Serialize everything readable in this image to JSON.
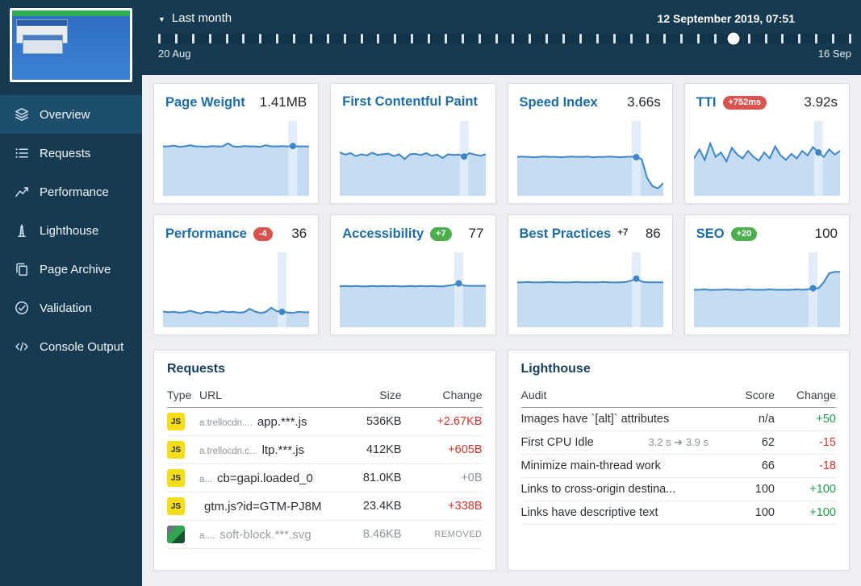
{
  "colors": {
    "sidebar_bg": "#153a52",
    "active_item_bg": "#1d4e6e",
    "accent_blue": "#1b6ca8",
    "chart_line": "#3e86c7",
    "chart_fill": "#c5dcf2",
    "badge_red": "#d9534f",
    "badge_green": "#4cae4c",
    "text_red": "#d9342b",
    "text_green": "#1f9d49"
  },
  "sidebar": {
    "items": [
      {
        "label": "Overview",
        "icon": "layers-icon",
        "active": true
      },
      {
        "label": "Requests",
        "icon": "list-icon",
        "active": false
      },
      {
        "label": "Performance",
        "icon": "performance-chart-icon",
        "active": false
      },
      {
        "label": "Lighthouse",
        "icon": "lighthouse-icon",
        "active": false
      },
      {
        "label": "Page Archive",
        "icon": "pages-icon",
        "active": false
      },
      {
        "label": "Validation",
        "icon": "check-circle-icon",
        "active": false
      },
      {
        "label": "Console Output",
        "icon": "code-icon",
        "active": false
      }
    ]
  },
  "timebar": {
    "range_label": "Last month",
    "current_datetime": "12 September 2019, 07:51",
    "start_label": "20 Aug",
    "end_label": "16 Sep",
    "tick_count": 42,
    "handle_position": 0.83
  },
  "cards": [
    {
      "title": "Page Weight",
      "value": "1.41MB",
      "badge": null,
      "cursor": 24,
      "spark": [
        0.66,
        0.66,
        0.67,
        0.655,
        0.66,
        0.675,
        0.66,
        0.66,
        0.655,
        0.665,
        0.66,
        0.66,
        0.7,
        0.66,
        0.655,
        0.665,
        0.66,
        0.66,
        0.655,
        0.675,
        0.66,
        0.66,
        0.665,
        0.66,
        0.665,
        0.66,
        0.66,
        0.66
      ]
    },
    {
      "title": "First Contentful Paint",
      "value": "",
      "badge": null,
      "cursor": 23,
      "spark": [
        0.58,
        0.55,
        0.57,
        0.53,
        0.555,
        0.54,
        0.575,
        0.545,
        0.555,
        0.565,
        0.53,
        0.555,
        0.49,
        0.555,
        0.56,
        0.545,
        0.57,
        0.535,
        0.55,
        0.505,
        0.555,
        0.545,
        0.55,
        0.525,
        0.57,
        0.55,
        0.535,
        0.555
      ]
    },
    {
      "title": "Speed Index",
      "value": "3.66s",
      "badge": null,
      "cursor": 22,
      "spark": [
        0.52,
        0.525,
        0.52,
        0.515,
        0.52,
        0.525,
        0.52,
        0.52,
        0.515,
        0.52,
        0.525,
        0.52,
        0.52,
        0.525,
        0.515,
        0.52,
        0.52,
        0.525,
        0.52,
        0.515,
        0.52,
        0.525,
        0.515,
        0.49,
        0.24,
        0.13,
        0.1,
        0.17
      ]
    },
    {
      "title": "TTI",
      "value": "3.92s",
      "badge": {
        "text": "+752ms",
        "style": "red"
      },
      "cursor": 23,
      "spark": [
        0.5,
        0.62,
        0.48,
        0.7,
        0.52,
        0.58,
        0.46,
        0.64,
        0.55,
        0.5,
        0.6,
        0.52,
        0.47,
        0.58,
        0.5,
        0.66,
        0.54,
        0.48,
        0.56,
        0.5,
        0.6,
        0.54,
        0.65,
        0.58,
        0.52,
        0.62,
        0.55,
        0.6
      ]
    },
    {
      "title": "Performance",
      "value": "36",
      "badge": {
        "text": "-4",
        "style": "red"
      },
      "cursor": 22,
      "spark": [
        0.21,
        0.2,
        0.205,
        0.195,
        0.2,
        0.22,
        0.2,
        0.185,
        0.205,
        0.2,
        0.195,
        0.215,
        0.2,
        0.205,
        0.195,
        0.2,
        0.245,
        0.21,
        0.19,
        0.205,
        0.26,
        0.215,
        0.205,
        0.198,
        0.19,
        0.205,
        0.2,
        0.2
      ]
    },
    {
      "title": "Accessibility",
      "value": "77",
      "badge": {
        "text": "+7",
        "style": "green"
      },
      "cursor": 22,
      "spark": [
        0.545,
        0.55,
        0.545,
        0.55,
        0.545,
        0.545,
        0.55,
        0.545,
        0.55,
        0.545,
        0.55,
        0.545,
        0.545,
        0.55,
        0.545,
        0.55,
        0.545,
        0.55,
        0.545,
        0.545,
        0.555,
        0.565,
        0.585,
        0.555,
        0.553,
        0.553,
        0.553,
        0.553
      ]
    },
    {
      "title": "Best Practices",
      "value": "86",
      "badge": {
        "text": "+7",
        "style": "plain"
      },
      "cursor": 22,
      "spark": [
        0.6,
        0.6,
        0.605,
        0.598,
        0.6,
        0.6,
        0.605,
        0.6,
        0.6,
        0.598,
        0.6,
        0.605,
        0.6,
        0.6,
        0.6,
        0.6,
        0.605,
        0.6,
        0.598,
        0.6,
        0.603,
        0.62,
        0.648,
        0.61,
        0.6,
        0.6,
        0.6,
        0.6
      ]
    },
    {
      "title": "SEO",
      "value": "100",
      "badge": {
        "text": "+20",
        "style": "green"
      },
      "cursor": 22,
      "spark": [
        0.5,
        0.5,
        0.505,
        0.498,
        0.5,
        0.5,
        0.505,
        0.5,
        0.5,
        0.498,
        0.505,
        0.5,
        0.5,
        0.5,
        0.505,
        0.5,
        0.5,
        0.5,
        0.5,
        0.505,
        0.5,
        0.505,
        0.52,
        0.52,
        0.6,
        0.72,
        0.74,
        0.74
      ]
    }
  ],
  "requests": {
    "title": "Requests",
    "headers": [
      "Type",
      "URL",
      "Size",
      "Change"
    ],
    "js_badge": "JS",
    "rows": [
      {
        "type": "js",
        "url_prefix": "a.trellocdn....",
        "url": "app.***.js",
        "size": "536KB",
        "change": "+2.67KB",
        "change_color": "red"
      },
      {
        "type": "js",
        "url_prefix": "a.trellocdn.c...",
        "url": "ltp.***.js",
        "size": "412KB",
        "change": "+605B",
        "change_color": "red"
      },
      {
        "type": "js",
        "url_prefix": "a...",
        "url": "cb=gapi.loaded_0",
        "size": "81.0KB",
        "change": "+0B",
        "change_color": "gray"
      },
      {
        "type": "js",
        "url_prefix": "",
        "url": "gtm.js?id=GTM-PJ8M",
        "size": "23.4KB",
        "change": "+338B",
        "change_color": "red"
      },
      {
        "type": "image",
        "url_prefix": "a....",
        "url": "soft-block.***.svg",
        "size": "8.46KB",
        "change": "REMOVED",
        "change_color": "gray"
      }
    ]
  },
  "lighthouse": {
    "title": "Lighthouse",
    "headers": [
      "Audit",
      "Score",
      "Change"
    ],
    "rows": [
      {
        "audit": "Images have `[alt]` attributes",
        "detail": "",
        "score": "n/a",
        "change": "+50",
        "change_color": "green"
      },
      {
        "audit": "First CPU Idle",
        "detail": "3.2 s ➜ 3.9 s",
        "score": "62",
        "change": "-15",
        "change_color": "red"
      },
      {
        "audit": "Minimize main-thread work",
        "detail": "",
        "score": "66",
        "change": "-18",
        "change_color": "red"
      },
      {
        "audit": "Links to cross-origin destina...",
        "detail": "",
        "score": "100",
        "change": "+100",
        "change_color": "green"
      },
      {
        "audit": "Links have descriptive text",
        "detail": "",
        "score": "100",
        "change": "+100",
        "change_color": "green"
      }
    ]
  }
}
